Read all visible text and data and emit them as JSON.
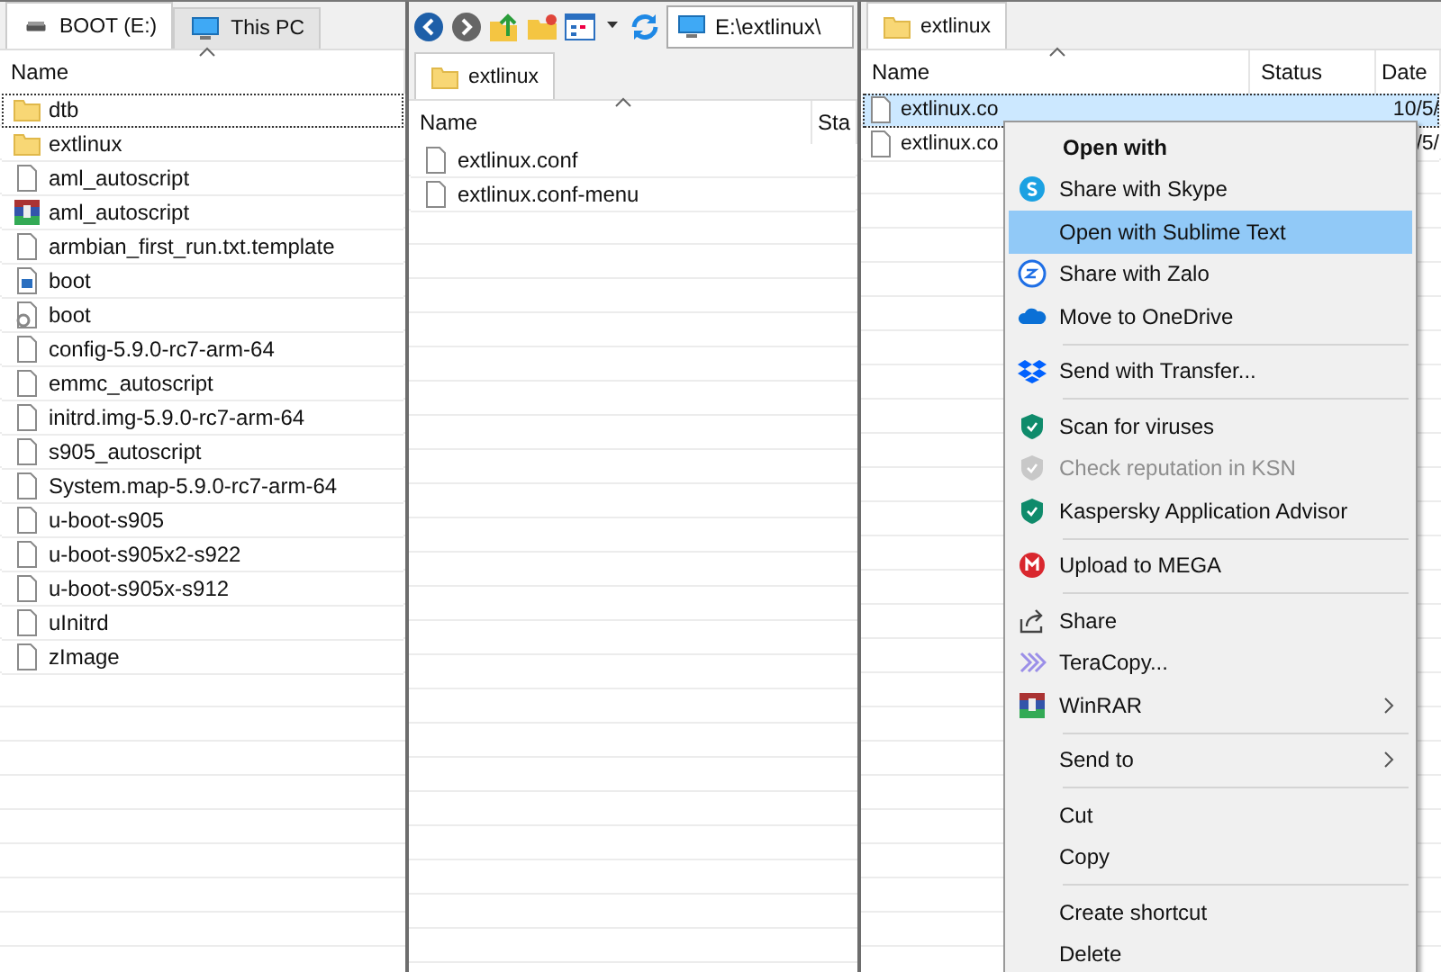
{
  "panes": [
    {
      "tabs": [
        {
          "label": "BOOT (E:)",
          "kind": "drive",
          "selected": true
        },
        {
          "label": "This PC",
          "kind": "pc",
          "selected": false
        }
      ],
      "columns": [
        "Name"
      ],
      "rows": [
        {
          "cells": [
            "dtb"
          ],
          "kind": "folder",
          "focused": true,
          "selected": false
        },
        {
          "cells": [
            "extlinux"
          ],
          "kind": "folder",
          "focused": false,
          "selected": false
        },
        {
          "cells": [
            "aml_autoscript"
          ],
          "kind": "file",
          "focused": false,
          "selected": false
        },
        {
          "cells": [
            "aml_autoscript"
          ],
          "kind": "winrar",
          "focused": false,
          "selected": false
        },
        {
          "cells": [
            "armbian_first_run.txt.template"
          ],
          "kind": "file",
          "focused": false,
          "selected": false
        },
        {
          "cells": [
            "boot"
          ],
          "kind": "image",
          "focused": false,
          "selected": false
        },
        {
          "cells": [
            "boot"
          ],
          "kind": "gear",
          "focused": false,
          "selected": false
        },
        {
          "cells": [
            "config-5.9.0-rc7-arm-64"
          ],
          "kind": "file",
          "focused": false,
          "selected": false
        },
        {
          "cells": [
            "emmc_autoscript"
          ],
          "kind": "file",
          "focused": false,
          "selected": false
        },
        {
          "cells": [
            "initrd.img-5.9.0-rc7-arm-64"
          ],
          "kind": "file",
          "focused": false,
          "selected": false
        },
        {
          "cells": [
            "s905_autoscript"
          ],
          "kind": "file",
          "focused": false,
          "selected": false
        },
        {
          "cells": [
            "System.map-5.9.0-rc7-arm-64"
          ],
          "kind": "file",
          "focused": false,
          "selected": false
        },
        {
          "cells": [
            "u-boot-s905"
          ],
          "kind": "file",
          "focused": false,
          "selected": false
        },
        {
          "cells": [
            "u-boot-s905x2-s922"
          ],
          "kind": "file",
          "focused": false,
          "selected": false
        },
        {
          "cells": [
            "u-boot-s905x-s912"
          ],
          "kind": "file",
          "focused": false,
          "selected": false
        },
        {
          "cells": [
            "uInitrd"
          ],
          "kind": "file",
          "focused": false,
          "selected": false
        },
        {
          "cells": [
            "zImage"
          ],
          "kind": "file",
          "focused": false,
          "selected": false
        }
      ]
    },
    {
      "toolbar": {
        "address": "E:\\extlinux\\"
      },
      "tabs": [
        {
          "label": "extlinux",
          "kind": "folder",
          "selected": true
        }
      ],
      "columns": [
        "Name",
        "Sta"
      ],
      "rows": [
        {
          "cells": [
            "extlinux.conf"
          ],
          "kind": "file",
          "focused": false,
          "selected": false
        },
        {
          "cells": [
            "extlinux.conf-menu"
          ],
          "kind": "file",
          "focused": false,
          "selected": false
        }
      ]
    },
    {
      "tabs": [
        {
          "label": "extlinux",
          "kind": "folder",
          "selected": true
        }
      ],
      "columns": [
        "Name",
        "Status",
        "Date"
      ],
      "rows": [
        {
          "cells": [
            "extlinux.co",
            "",
            "10/5/"
          ],
          "kind": "file",
          "focused": true,
          "selected": true
        },
        {
          "cells": [
            "extlinux.co",
            "",
            "/5/"
          ],
          "kind": "file",
          "focused": false,
          "selected": false
        }
      ]
    }
  ],
  "context_menu": {
    "items": [
      {
        "kind": "header",
        "label": "Open with"
      },
      {
        "kind": "skype",
        "label": "Share with Skype",
        "selected": false,
        "disabled": false,
        "submenu": false
      },
      {
        "kind": "text",
        "label": "Open with Sublime Text",
        "selected": true,
        "disabled": false,
        "submenu": false
      },
      {
        "kind": "zalo",
        "label": "Share with Zalo",
        "selected": false,
        "disabled": false,
        "submenu": false
      },
      {
        "kind": "cloud",
        "label": "Move to OneDrive",
        "selected": false,
        "disabled": false,
        "submenu": false
      },
      {
        "kind": "separator"
      },
      {
        "kind": "dropbox",
        "label": "Send with Transfer...",
        "selected": false,
        "disabled": false,
        "submenu": false
      },
      {
        "kind": "separator"
      },
      {
        "kind": "shield",
        "label": "Scan for viruses",
        "selected": false,
        "disabled": false,
        "submenu": false
      },
      {
        "kind": "shield",
        "label": "Check reputation in KSN",
        "selected": false,
        "disabled": true,
        "submenu": false
      },
      {
        "kind": "shield",
        "label": "Kaspersky Application Advisor",
        "selected": false,
        "disabled": false,
        "submenu": false
      },
      {
        "kind": "separator"
      },
      {
        "kind": "mega",
        "label": "Upload to MEGA",
        "selected": false,
        "disabled": false,
        "submenu": false
      },
      {
        "kind": "separator"
      },
      {
        "kind": "share",
        "label": "Share",
        "selected": false,
        "disabled": false,
        "submenu": false
      },
      {
        "kind": "chevrons",
        "label": "TeraCopy...",
        "selected": false,
        "disabled": false,
        "submenu": false
      },
      {
        "kind": "winrar",
        "label": "WinRAR",
        "selected": false,
        "disabled": false,
        "submenu": true
      },
      {
        "kind": "separator"
      },
      {
        "kind": "text",
        "label": "Send to",
        "selected": false,
        "disabled": false,
        "submenu": true
      },
      {
        "kind": "separator"
      },
      {
        "kind": "text",
        "label": "Cut",
        "selected": false,
        "disabled": false,
        "submenu": false
      },
      {
        "kind": "text",
        "label": "Copy",
        "selected": false,
        "disabled": false,
        "submenu": false
      },
      {
        "kind": "separator"
      },
      {
        "kind": "text",
        "label": "Create shortcut",
        "selected": false,
        "disabled": false,
        "submenu": false
      },
      {
        "kind": "text",
        "label": "Delete",
        "selected": false,
        "disabled": false,
        "submenu": false
      }
    ]
  }
}
